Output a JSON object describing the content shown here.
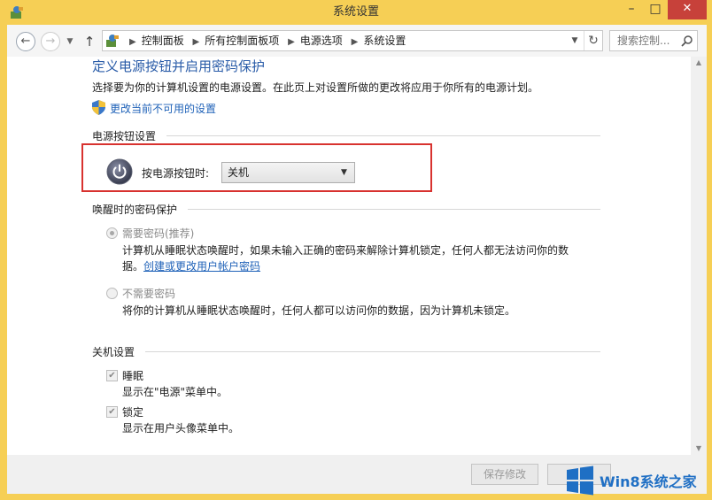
{
  "window": {
    "title": "系统设置",
    "minimize": "–",
    "maximize": "□",
    "close": "✕"
  },
  "nav": {
    "back": "←",
    "forward": "→",
    "up": "↑",
    "breadcrumbs": [
      "控制面板",
      "所有控制面板项",
      "电源选项",
      "系统设置"
    ],
    "search_placeholder": "搜索控制..."
  },
  "page": {
    "title": "定义电源按钮并启用密码保护",
    "description": "选择要为你的计算机设置的电源设置。在此页上对设置所做的更改将应用于你所有的电源计划。",
    "change_settings_link": "更改当前不可用的设置"
  },
  "power_button": {
    "section": "电源按钮设置",
    "label": "按电源按钮时:",
    "selected": "关机"
  },
  "wake_password": {
    "section": "唤醒时的密码保护",
    "require": {
      "label": "需要密码(推荐)",
      "checked": true,
      "desc_line1": "计算机从睡眠状态唤醒时，如果未输入正确的密码来解除计算机锁定，任何人都无法访问你的数",
      "desc_line2_prefix": "据。",
      "link": "创建或更改用户帐户密码"
    },
    "no_require": {
      "label": "不需要密码",
      "checked": false,
      "desc": "将你的计算机从睡眠状态唤醒时，任何人都可以访问你的数据，因为计算机未锁定。"
    }
  },
  "shutdown": {
    "section": "关机设置",
    "sleep": {
      "label": "睡眠",
      "checked": true,
      "desc": "显示在\"电源\"菜单中。"
    },
    "lock": {
      "label": "锁定",
      "checked": true,
      "desc": "显示在用户头像菜单中。"
    }
  },
  "footer": {
    "save": "保存修改",
    "cancel": ""
  },
  "watermark": {
    "text": "Win8系统之家"
  },
  "colors": {
    "frame": "#f6cf55",
    "accent_link": "#1f62b8",
    "title_blue": "#2a5ca8",
    "highlight_red": "#d8322f",
    "close_red": "#c7413a"
  }
}
